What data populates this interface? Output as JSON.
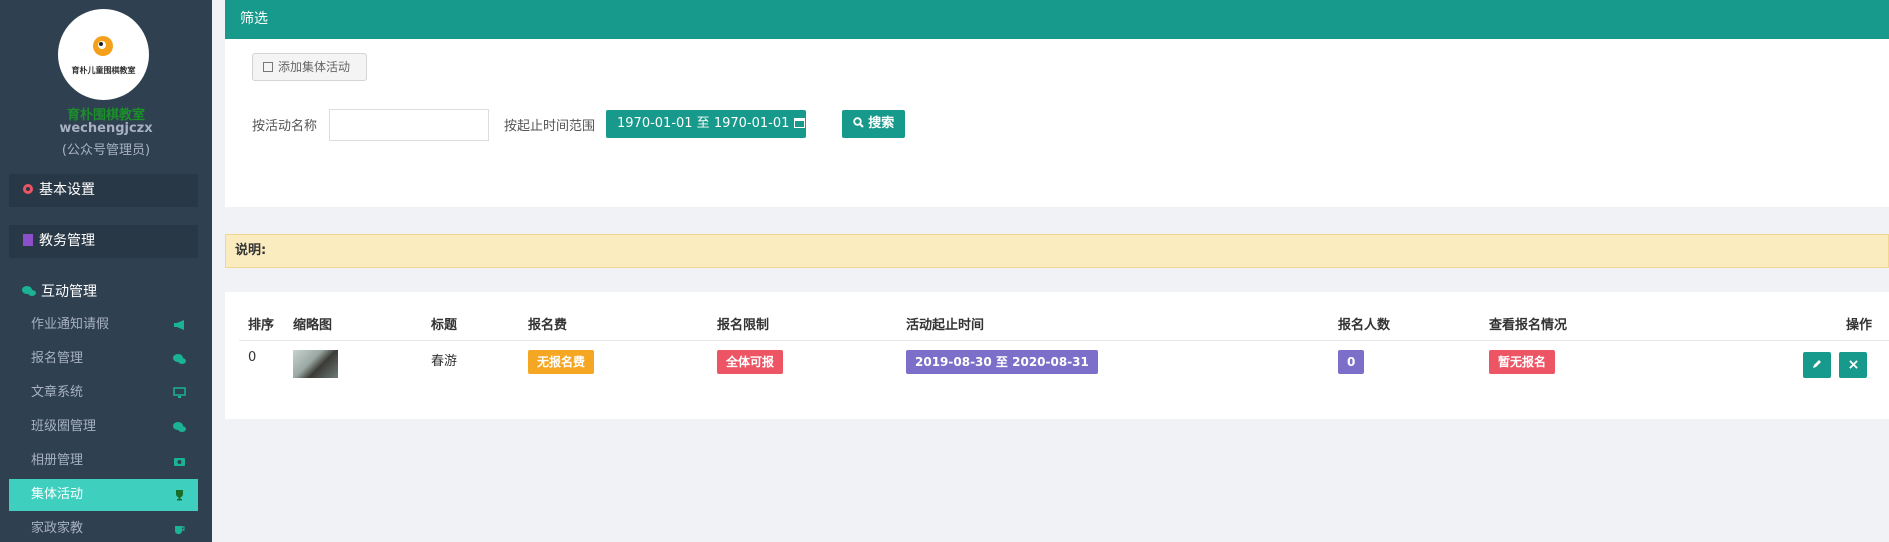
{
  "sidebar": {
    "logo_text": "育朴儿童围棋教室",
    "school_name": "育朴围棋教室",
    "username": "wechengjczx",
    "role": "(公众号管理员)",
    "groups": [
      {
        "label": "基本设置",
        "icon": "gear-icon"
      },
      {
        "label": "教务管理",
        "icon": "grid-icon"
      },
      {
        "label": "互动管理",
        "icon": "chat-icon"
      }
    ],
    "items": [
      {
        "label": "作业通知请假",
        "icon": "bullhorn-icon"
      },
      {
        "label": "报名管理",
        "icon": "chat-icon"
      },
      {
        "label": "文章系统",
        "icon": "monitor-icon"
      },
      {
        "label": "班级圈管理",
        "icon": "wechat-icon"
      },
      {
        "label": "相册管理",
        "icon": "camera-icon"
      },
      {
        "label": "集体活动",
        "icon": "trophy-icon",
        "active": true
      },
      {
        "label": "家政家教",
        "icon": "coffee-icon"
      }
    ]
  },
  "filter": {
    "title": "筛选",
    "add_button": "添加集体活动",
    "name_label": "按活动名称",
    "name_value": "",
    "range_label": "按起止时间范围",
    "range_value": "1970-01-01 至 1970-01-01",
    "search_button": "搜索"
  },
  "notice": {
    "label": "说明:"
  },
  "table": {
    "columns": [
      "排序",
      "缩略图",
      "标题",
      "报名费",
      "报名限制",
      "活动起止时间",
      "报名人数",
      "查看报名情况",
      "操作"
    ],
    "rows": [
      {
        "order": "0",
        "title": "春游",
        "fee": "无报名费",
        "limit": "全体可报",
        "period": "2019-08-30 至 2020-08-31",
        "count": "0",
        "status": "暂无报名"
      }
    ]
  },
  "colors": {
    "primary": "#17998b",
    "sidebar_bg": "#2f4050",
    "active_item": "#3fcfbf",
    "fee_badge": "#f5a623",
    "limit_badge": "#ed5565",
    "period_badge": "#7b6fc9",
    "count_badge": "#7b6fc9",
    "status_badge": "#ed5565"
  }
}
